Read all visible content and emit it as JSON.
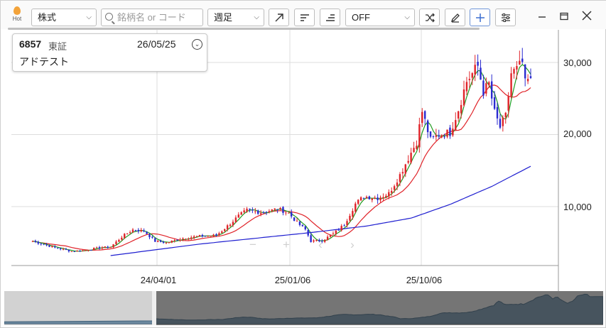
{
  "toolbar": {
    "hot_label": "Hot",
    "market_select": "株式",
    "search_placeholder": "銘柄名 or コード",
    "period_select": "週足",
    "mode_select": "OFF"
  },
  "info_panel": {
    "code": "6857",
    "market": "東証",
    "date": "26/05/25",
    "name": "アドテスト"
  },
  "chart_data": {
    "type": "candlestick",
    "x_tick_labels": [
      "24/04/01",
      "25/01/06",
      "25/10/06"
    ],
    "y_tick_labels": [
      "10,000",
      "20,000",
      "30,000"
    ],
    "ylim": [
      2000,
      33000
    ],
    "colors": {
      "up": "#e0242a",
      "down": "#2a2ad0",
      "ma_short": "#1f9a1f",
      "ma_mid": "#e0242a",
      "ma_long": "#1f1fd0"
    },
    "close_anchors": [
      [
        0,
        5200
      ],
      [
        8,
        4300
      ],
      [
        14,
        3800
      ],
      [
        18,
        3900
      ],
      [
        24,
        4300
      ],
      [
        28,
        4400
      ],
      [
        32,
        5800
      ],
      [
        36,
        6800
      ],
      [
        40,
        6600
      ],
      [
        44,
        5200
      ],
      [
        48,
        5000
      ],
      [
        54,
        5600
      ],
      [
        60,
        5900
      ],
      [
        66,
        6000
      ],
      [
        70,
        7300
      ],
      [
        74,
        8700
      ],
      [
        77,
        9500
      ],
      [
        82,
        9200
      ],
      [
        86,
        9500
      ],
      [
        88,
        9700
      ],
      [
        92,
        9100
      ],
      [
        95,
        7800
      ],
      [
        98,
        6800
      ],
      [
        100,
        5200
      ],
      [
        104,
        5300
      ],
      [
        108,
        6200
      ],
      [
        112,
        7500
      ],
      [
        116,
        10400
      ],
      [
        119,
        11400
      ],
      [
        124,
        11200
      ],
      [
        128,
        11800
      ],
      [
        132,
        14400
      ],
      [
        136,
        17500
      ],
      [
        138,
        19000
      ],
      [
        140,
        23200
      ],
      [
        143,
        19200
      ],
      [
        146,
        20000
      ],
      [
        150,
        20300
      ],
      [
        153,
        23500
      ],
      [
        156,
        27400
      ],
      [
        160,
        29500
      ],
      [
        162,
        26000
      ],
      [
        164,
        27000
      ],
      [
        166,
        23000
      ],
      [
        168,
        21000
      ],
      [
        170,
        22500
      ],
      [
        172,
        28500
      ],
      [
        174,
        29000
      ],
      [
        176,
        30000
      ],
      [
        177,
        27000
      ],
      [
        178,
        27500
      ],
      [
        179,
        27300
      ]
    ],
    "ma_long_anchors": [
      [
        28,
        3200
      ],
      [
        60,
        4800
      ],
      [
        100,
        6400
      ],
      [
        120,
        7300
      ],
      [
        136,
        8400
      ],
      [
        150,
        10300
      ],
      [
        165,
        12800
      ],
      [
        179,
        15600
      ]
    ]
  }
}
